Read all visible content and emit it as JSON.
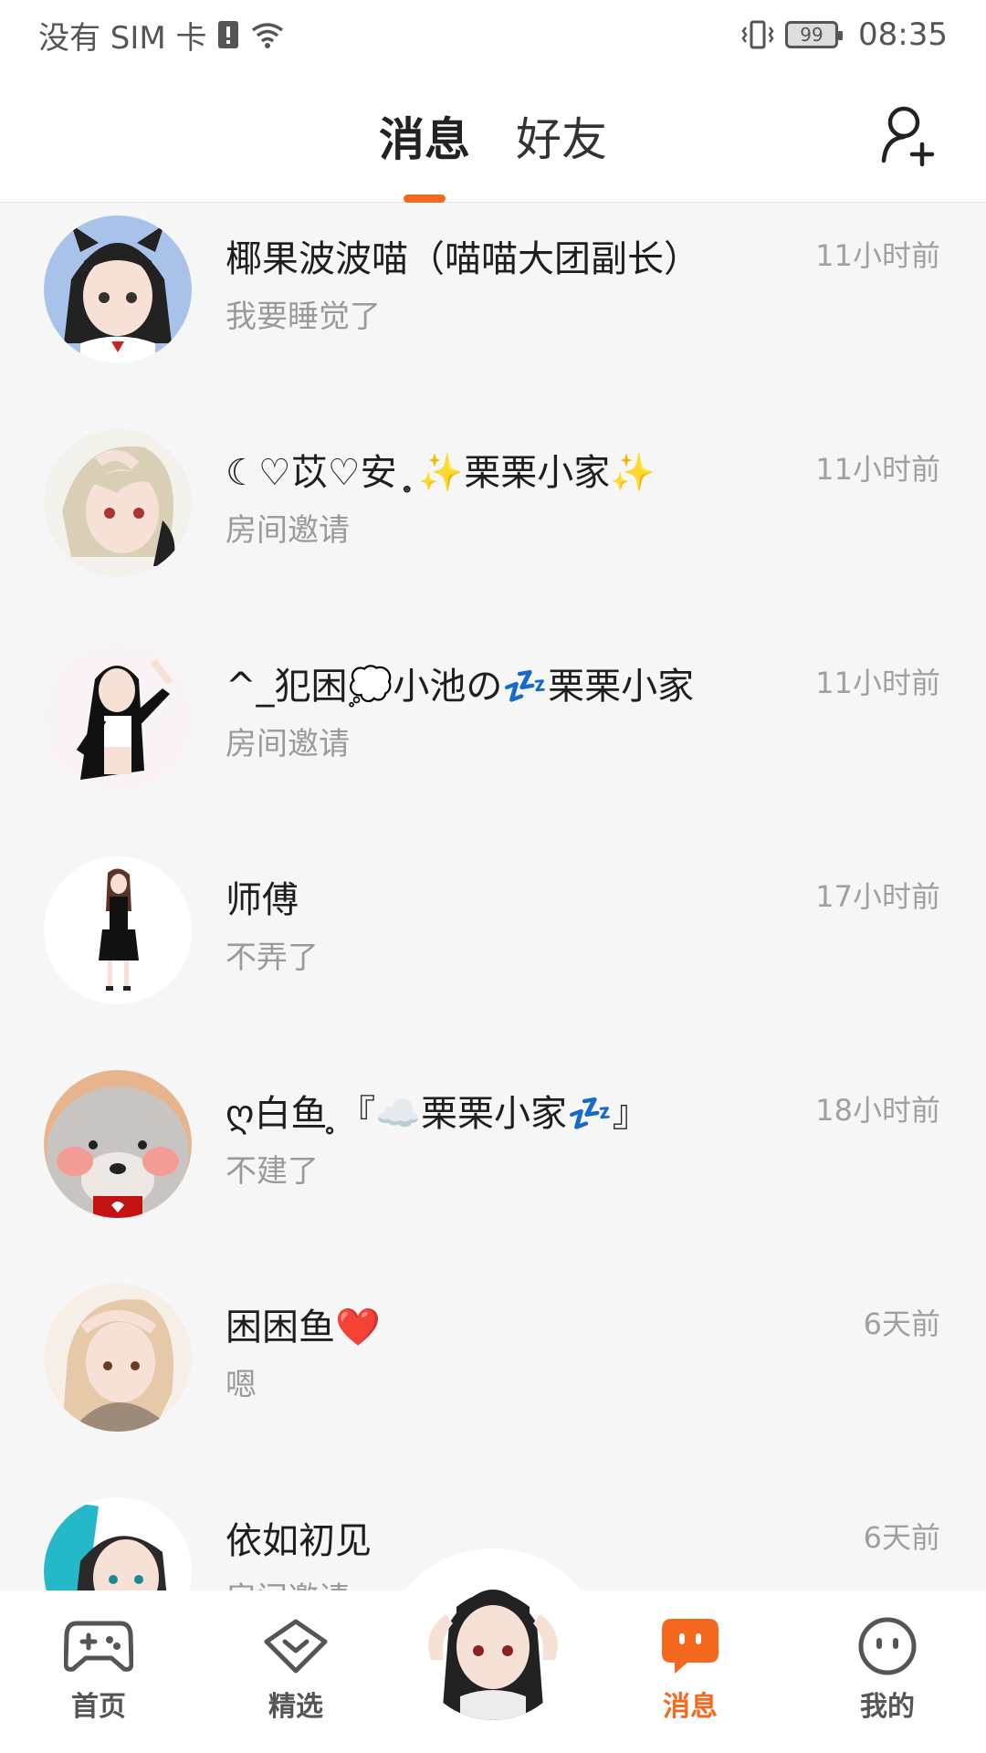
{
  "status_bar": {
    "carrier": "没有 SIM 卡",
    "battery": "99",
    "time": "08:35"
  },
  "header": {
    "tabs": [
      {
        "label": "消息",
        "active": true
      },
      {
        "label": "好友",
        "active": false
      }
    ],
    "add_friend_icon": "add-user-icon"
  },
  "messages": [
    {
      "name": "椰果波波喵（喵喵大团副长）",
      "preview": "我要睡觉了",
      "time": "11小时前",
      "avatar_colors": [
        "#a9c2ea",
        "#222",
        "#f7e0d6"
      ]
    },
    {
      "name": "☾♡苡♡安 ̥͙ ✨栗栗小家✨",
      "preview": "房间邀请",
      "time": "11小时前",
      "avatar_colors": [
        "#f3f1ec",
        "#d9cfb6",
        "#f7e0d6"
      ]
    },
    {
      "name": "^_犯困💭小池の💤栗栗小家",
      "preview": "房间邀请",
      "time": "11小时前",
      "avatar_colors": [
        "#faf3f5",
        "#111",
        "#f7e0d6"
      ]
    },
    {
      "name": "师傅",
      "preview": "不弄了",
      "time": "17小时前",
      "avatar_colors": [
        "#ffffff",
        "#5b3524",
        "#f7e0d6"
      ]
    },
    {
      "name": "ღ白鱼 ̥『☁️栗栗小家💤』",
      "preview": "不建了",
      "time": "18小时前",
      "avatar_colors": [
        "#e7b48e",
        "#c8c4c1",
        "#f29c96"
      ]
    },
    {
      "name": "困困鱼❤️",
      "preview": "嗯",
      "time": "6天前",
      "avatar_colors": [
        "#f6efe8",
        "#e6c9a8",
        "#f7e0d6"
      ]
    },
    {
      "name": "依如初见",
      "preview": "房间邀请",
      "time": "6天前",
      "avatar_colors": [
        "#25b8c8",
        "#2a2a2a",
        "#f7e0d6"
      ]
    }
  ],
  "bottom_nav": {
    "items": [
      {
        "label": "首页",
        "icon": "gamepad-icon",
        "active": false
      },
      {
        "label": "精选",
        "icon": "heart-badge-icon",
        "active": false
      },
      {
        "label": "消息",
        "icon": "chat-bubble-icon",
        "active": true
      },
      {
        "label": "我的",
        "icon": "smile-face-icon",
        "active": false
      }
    ],
    "center_icon": "user-avatar"
  },
  "colors": {
    "accent": "#f5691e",
    "background": "#f6f6f6",
    "name_text": "#1e1e1e",
    "secondary_text": "#9a9a9a"
  }
}
